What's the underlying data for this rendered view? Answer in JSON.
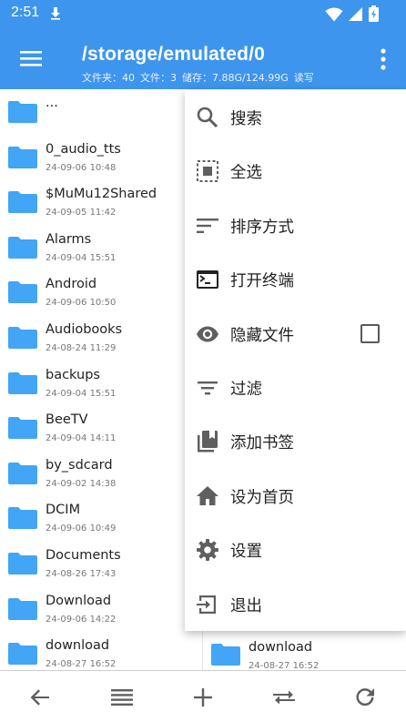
{
  "status": {
    "time": "2:51"
  },
  "appbar": {
    "path": "/storage/emulated/0",
    "info": {
      "folders": "文件夹：40",
      "files": "文件：3",
      "storage": "储存：7.88G/124.99G",
      "mode": "读写"
    }
  },
  "files": [
    {
      "name": "...",
      "date": ""
    },
    {
      "name": "0_audio_tts",
      "date": "24-09-06 10:48"
    },
    {
      "name": "$MuMu12Shared",
      "date": "24-09-05 11:42"
    },
    {
      "name": "Alarms",
      "date": "24-09-04 15:51"
    },
    {
      "name": "Android",
      "date": "24-09-06 10:50"
    },
    {
      "name": "Audiobooks",
      "date": "24-08-24 11:29"
    },
    {
      "name": "backups",
      "date": "24-09-04 15:51"
    },
    {
      "name": "BeeTV",
      "date": "24-09-04 14:11"
    },
    {
      "name": "by_sdcard",
      "date": "24-09-02 14:38"
    },
    {
      "name": "DCIM",
      "date": "24-09-06 10:49"
    },
    {
      "name": "Documents",
      "date": "24-08-26 17:43"
    },
    {
      "name": "Download",
      "date": "24-09-06 14:22"
    },
    {
      "name": "download",
      "date": "24-08-27 16:52"
    }
  ],
  "right_pane": {
    "name": "download",
    "date": "24-08-27 16:52"
  },
  "menu": [
    {
      "label": "搜索",
      "icon": "search-icon"
    },
    {
      "label": "全选",
      "icon": "select-all-icon"
    },
    {
      "label": "排序方式",
      "icon": "sort-icon"
    },
    {
      "label": "打开终端",
      "icon": "terminal-icon"
    },
    {
      "label": "隐藏文件",
      "icon": "eye-icon",
      "checkbox": false
    },
    {
      "label": "过滤",
      "icon": "filter-icon"
    },
    {
      "label": "添加书签",
      "icon": "bookmark-icon"
    },
    {
      "label": "设为首页",
      "icon": "home-icon"
    },
    {
      "label": "设置",
      "icon": "gear-icon"
    },
    {
      "label": "退出",
      "icon": "exit-icon"
    }
  ],
  "toolbar": [
    "back-arrow-icon",
    "list-icon",
    "plus-icon",
    "swap-icon",
    "refresh-icon"
  ],
  "colors": {
    "primary": "#3d95ed",
    "folder": "#42a5f5",
    "icon": "#5f5f5f"
  }
}
